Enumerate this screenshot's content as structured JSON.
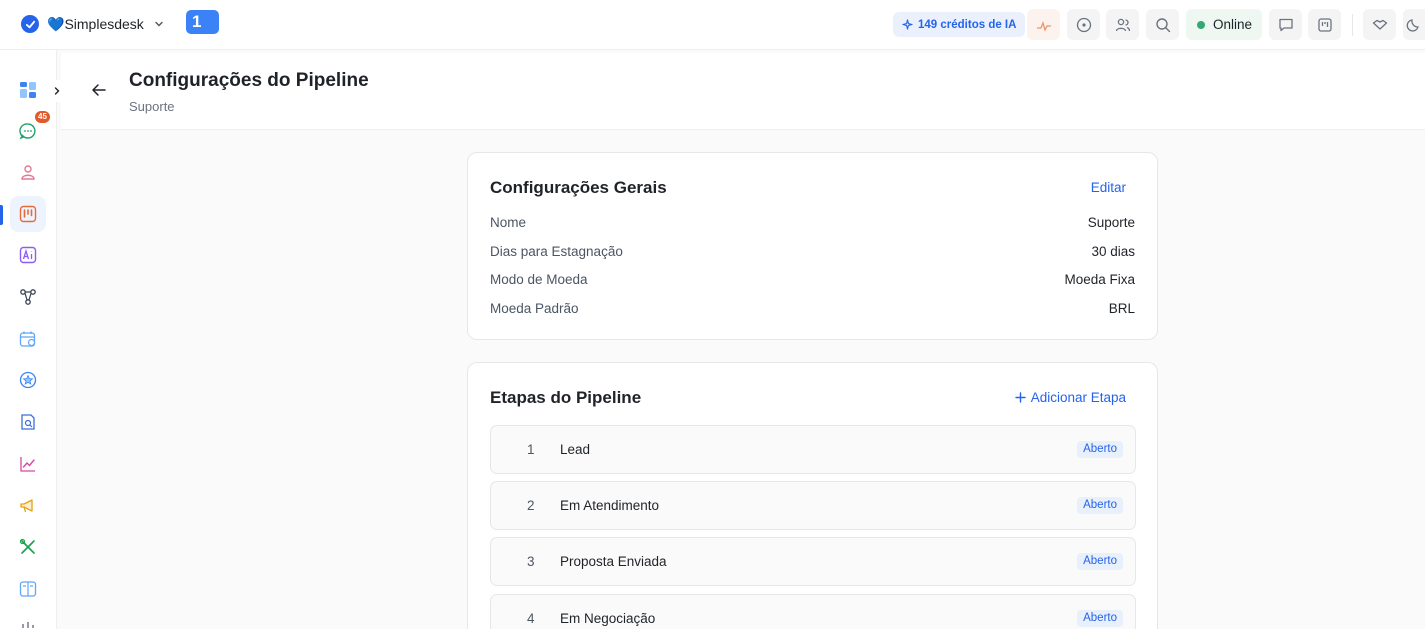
{
  "topbar": {
    "brand_name": "Simplesdesk",
    "brand_heart": "💙",
    "notification_chip": "1",
    "credits_label": "149 créditos de IA",
    "online_label": "Online"
  },
  "sidebar": {
    "expand_icon": "chevron-right-icon",
    "chat_badge": "45",
    "items": [
      {
        "name": "dashboard-icon",
        "color": "#3b82f6"
      },
      {
        "name": "chat-icon",
        "color": "#22a06b"
      },
      {
        "name": "contacts-icon",
        "color": "#e07a95"
      },
      {
        "name": "kanban-icon",
        "color": "#e86a3a",
        "active": true
      },
      {
        "name": "ai-assistant-icon",
        "color": "#8b5cf6"
      },
      {
        "name": "flow-icon",
        "color": "#374151"
      },
      {
        "name": "schedule-icon",
        "color": "#60a5fa"
      },
      {
        "name": "star-icon",
        "color": "#3b82f6"
      },
      {
        "name": "reports-icon",
        "color": "#3b6fd8"
      },
      {
        "name": "analytics-icon",
        "color": "#d946a8"
      },
      {
        "name": "campaigns-icon",
        "color": "#e5a21b"
      },
      {
        "name": "tools-icon",
        "color": "#16a34a"
      },
      {
        "name": "docs-icon",
        "color": "#60a5fa"
      }
    ]
  },
  "header": {
    "title": "Configurações do Pipeline",
    "subtitle": "Suporte"
  },
  "general": {
    "title": "Configurações Gerais",
    "edit_label": "Editar",
    "rows": [
      {
        "label": "Nome",
        "value": "Suporte"
      },
      {
        "label": "Dias para Estagnação",
        "value": "30 dias"
      },
      {
        "label": "Modo de Moeda",
        "value": "Moeda Fixa"
      },
      {
        "label": "Moeda Padrão",
        "value": "BRL"
      }
    ]
  },
  "stages": {
    "title": "Etapas do Pipeline",
    "add_label": "Adicionar Etapa",
    "items": [
      {
        "num": "1",
        "name": "Lead",
        "status": "Aberto"
      },
      {
        "num": "2",
        "name": "Em Atendimento",
        "status": "Aberto"
      },
      {
        "num": "3",
        "name": "Proposta Enviada",
        "status": "Aberto"
      },
      {
        "num": "4",
        "name": "Em Negociação",
        "status": "Aberto"
      }
    ]
  }
}
